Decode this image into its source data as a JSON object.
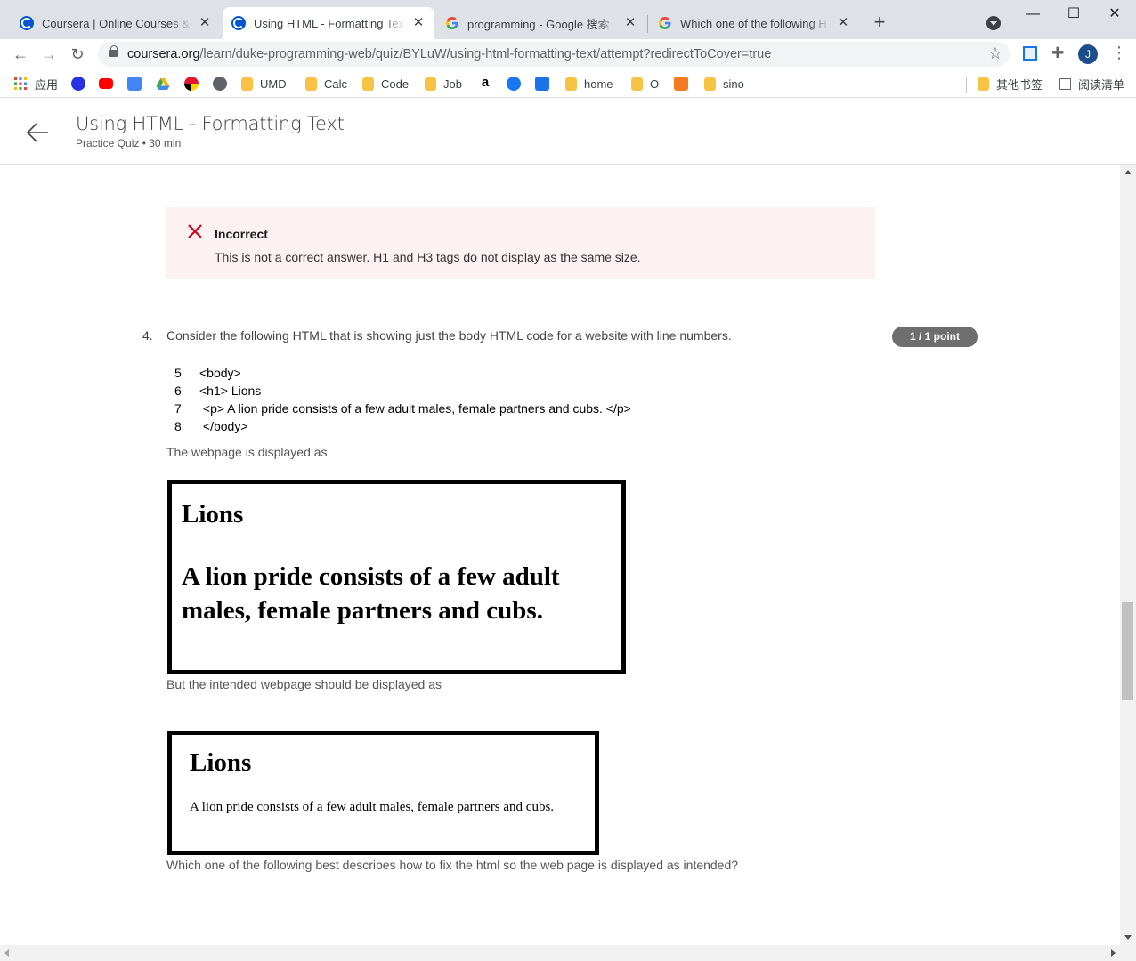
{
  "browser": {
    "tabs": [
      {
        "title": "Coursera | Online Courses & C",
        "favicon": "coursera-icon",
        "active": false
      },
      {
        "title": "Using HTML - Formatting Text",
        "favicon": "coursera-icon",
        "active": true
      },
      {
        "title": "programming - Google 搜索",
        "favicon": "google-icon",
        "active": false
      },
      {
        "title": "Which one of the following HT",
        "favicon": "google-icon",
        "active": false
      }
    ],
    "url_domain": "coursera.org",
    "url_path": "/learn/duke-programming-web/quiz/BYLuW/using-html-formatting-text/attempt?redirectToCover=true",
    "avatar_letter": "J",
    "bookmarks": [
      {
        "label": "应用",
        "icon": "apps-grid-icon"
      },
      {
        "label": "",
        "icon": "baidu-icon"
      },
      {
        "label": "",
        "icon": "youtube-icon"
      },
      {
        "label": "",
        "icon": "google-translate-icon"
      },
      {
        "label": "",
        "icon": "google-drive-icon"
      },
      {
        "label": "",
        "icon": "maryland-icon"
      },
      {
        "label": "",
        "icon": "globe-icon"
      },
      {
        "label": "UMD",
        "icon": "folder-icon"
      },
      {
        "label": "Calc",
        "icon": "folder-icon"
      },
      {
        "label": "Code",
        "icon": "folder-icon"
      },
      {
        "label": "Job",
        "icon": "folder-icon"
      },
      {
        "label": "",
        "icon": "amazon-icon"
      },
      {
        "label": "",
        "icon": "facebook-icon"
      },
      {
        "label": "",
        "icon": "translate-icon"
      },
      {
        "label": "home",
        "icon": "folder-icon"
      },
      {
        "label": "O",
        "icon": "folder-icon"
      },
      {
        "label": "",
        "icon": "c-app-icon"
      },
      {
        "label": "sino",
        "icon": "folder-icon"
      }
    ],
    "other_bookmarks": "其他书签",
    "reading_list": "阅读清单"
  },
  "header": {
    "title": "Using HTML - Formatting Text",
    "subtitle": "Practice Quiz • 30 min"
  },
  "feedback": {
    "title": "Incorrect",
    "text": "This is not a correct answer. H1 and H3 tags do not display as the same size."
  },
  "question": {
    "number": "4.",
    "text": "Consider the following HTML that is showing just the body HTML code for a website with line numbers.",
    "points": "1 / 1 point",
    "code_lines": [
      {
        "num": "5",
        "code": "<body>"
      },
      {
        "num": "6",
        "code": "<h1> Lions"
      },
      {
        "num": "7",
        "code": " <p> A lion pride consists of a few adult males, female partners and cubs. </p>"
      },
      {
        "num": "8",
        "code": " </body>"
      }
    ],
    "displayed_as": "The webpage is displayed as",
    "render_actual": {
      "heading": "Lions",
      "body": "A lion pride consists of a few adult males, female partners and cubs."
    },
    "intended_as": "But the intended webpage should be displayed as",
    "render_intended": {
      "heading": "Lions",
      "body": "A lion pride consists of a few adult males, female partners and cubs."
    },
    "prompt": "Which one of the following best describes how to fix the html so the web page is displayed as intended?"
  },
  "colors": {
    "feedback_bg": "#fdf2f2",
    "incorrect_red": "#d0021b",
    "points_badge": "#6e6e6e"
  }
}
